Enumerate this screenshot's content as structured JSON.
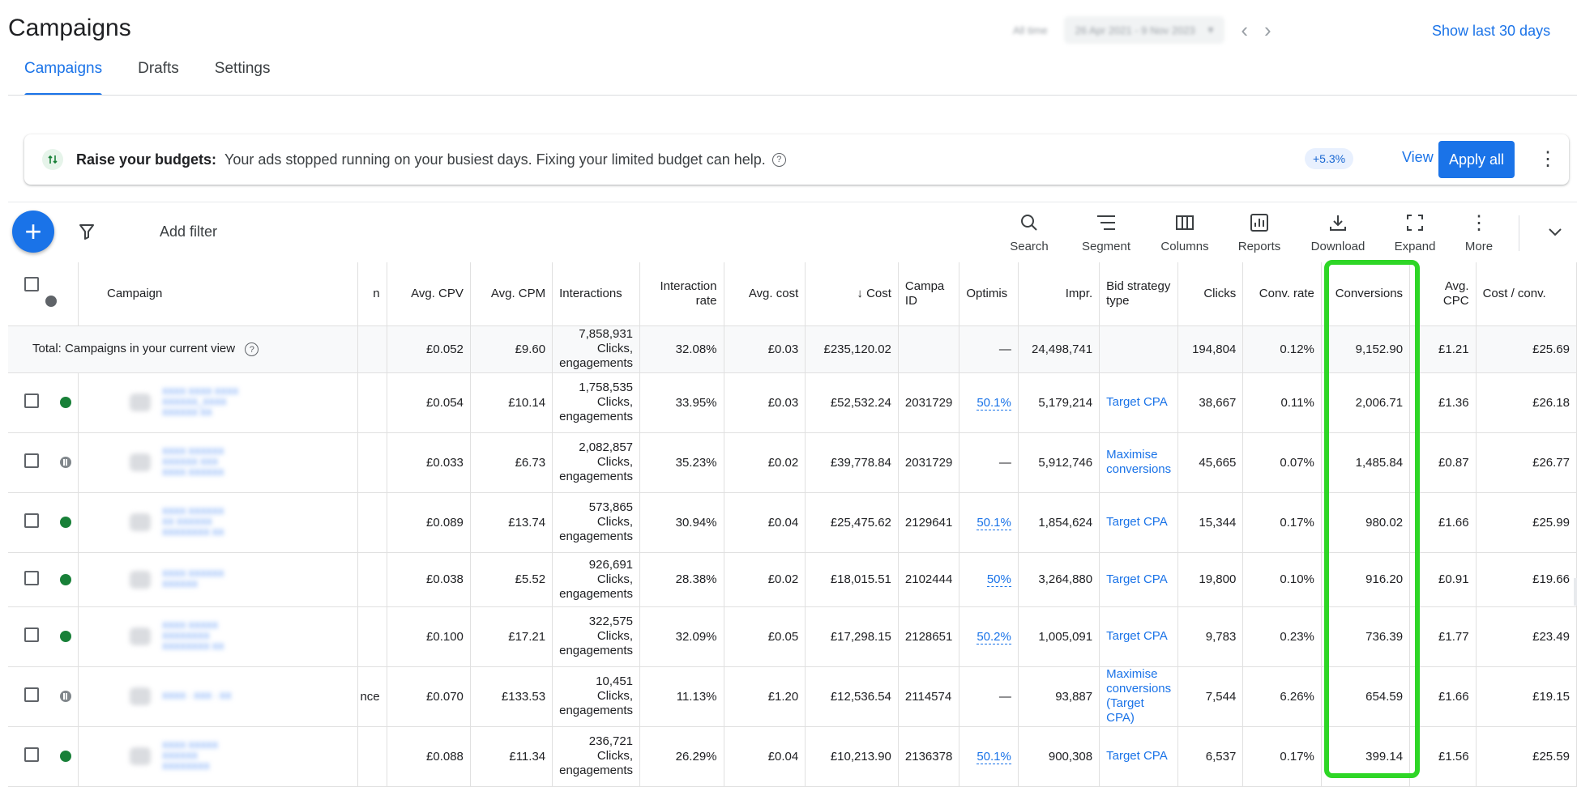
{
  "header": {
    "title": "Campaigns",
    "tabs": [
      "Campaigns",
      "Drafts",
      "Settings"
    ],
    "show_last": "Show last 30 days",
    "blurred_date_label": "All time",
    "blurred_date_range": "26 Apr 2021 - 9 Nov 2023"
  },
  "banner": {
    "title": "Raise your budgets:",
    "description": "Your ads stopped running on your busiest days. Fixing your limited budget can help.",
    "uplift": "+5.3%",
    "view": "View",
    "apply_all": "Apply all"
  },
  "toolbar": {
    "add_filter": "Add filter",
    "tools": [
      "Search",
      "Segment",
      "Columns",
      "Reports",
      "Download",
      "Expand",
      "More"
    ]
  },
  "table": {
    "headers": {
      "campaign": "Campaign",
      "avg_cpv": "Avg. CPV",
      "avg_cpm": "Avg. CPM",
      "interactions": "Interactions",
      "interaction_rate": "Interaction rate",
      "avg_cost": "Avg. cost",
      "cost": "Cost",
      "campaign_id": "Campa ID",
      "optimisation": "Optimis",
      "impr": "Impr.",
      "bid_strategy": "Bid strategy type",
      "clicks": "Clicks",
      "conv_rate": "Conv. rate",
      "conversions": "Conversions",
      "avg_cpc": "Avg. CPC",
      "cost_per_conv": "Cost / conv."
    },
    "total": {
      "label": "Total: Campaigns in your current view",
      "avg_cpv": "£0.052",
      "avg_cpm": "£9.60",
      "interactions": "7,858,931 Clicks, engagements",
      "interaction_rate": "32.08%",
      "avg_cost": "£0.03",
      "cost": "£235,120.02",
      "campaign_id": "",
      "optimisation": "—",
      "impr": "24,498,741",
      "bid_strategy": "",
      "clicks": "194,804",
      "conv_rate": "0.12%",
      "conversions": "9,152.90",
      "avg_cpc": "£1.21",
      "cost_per_conv": "£25.69"
    },
    "rows": [
      {
        "status": "enabled",
        "extra": "",
        "avg_cpv": "£0.054",
        "avg_cpm": "£10.14",
        "interactions": "1,758,535 Clicks, engagements",
        "interaction_rate": "33.95%",
        "avg_cost": "£0.03",
        "cost": "£52,532.24",
        "campaign_id": "2031729",
        "optimisation": "50.1%",
        "impr": "5,179,214",
        "bid_strategy": "Target CPA",
        "clicks": "38,667",
        "conv_rate": "0.11%",
        "conversions": "2,006.71",
        "avg_cpc": "£1.36",
        "cost_per_conv": "£26.18"
      },
      {
        "status": "paused",
        "extra": "",
        "avg_cpv": "£0.033",
        "avg_cpm": "£6.73",
        "interactions": "2,082,857 Clicks, engagements",
        "interaction_rate": "35.23%",
        "avg_cost": "£0.02",
        "cost": "£39,778.84",
        "campaign_id": "2031729",
        "optimisation": "—",
        "impr": "5,912,746",
        "bid_strategy": "Maximise conversions",
        "clicks": "45,665",
        "conv_rate": "0.07%",
        "conversions": "1,485.84",
        "avg_cpc": "£0.87",
        "cost_per_conv": "£26.77"
      },
      {
        "status": "enabled",
        "extra": "",
        "avg_cpv": "£0.089",
        "avg_cpm": "£13.74",
        "interactions": "573,865 Clicks, engagements",
        "interaction_rate": "30.94%",
        "avg_cost": "£0.04",
        "cost": "£25,475.62",
        "campaign_id": "2129641",
        "optimisation": "50.1%",
        "impr": "1,854,624",
        "bid_strategy": "Target CPA",
        "clicks": "15,344",
        "conv_rate": "0.17%",
        "conversions": "980.02",
        "avg_cpc": "£1.66",
        "cost_per_conv": "£25.99"
      },
      {
        "status": "enabled",
        "extra": "",
        "avg_cpv": "£0.038",
        "avg_cpm": "£5.52",
        "interactions": "926,691 Clicks, engagements",
        "interaction_rate": "28.38%",
        "avg_cost": "£0.02",
        "cost": "£18,015.51",
        "campaign_id": "2102444",
        "optimisation": "50%",
        "impr": "3,264,880",
        "bid_strategy": "Target CPA",
        "clicks": "19,800",
        "conv_rate": "0.10%",
        "conversions": "916.20",
        "avg_cpc": "£0.91",
        "cost_per_conv": "£19.66"
      },
      {
        "status": "enabled",
        "extra": "",
        "avg_cpv": "£0.100",
        "avg_cpm": "£17.21",
        "interactions": "322,575 Clicks, engagements",
        "interaction_rate": "32.09%",
        "avg_cost": "£0.05",
        "cost": "£17,298.15",
        "campaign_id": "2128651",
        "optimisation": "50.2%",
        "impr": "1,005,091",
        "bid_strategy": "Target CPA",
        "clicks": "9,783",
        "conv_rate": "0.23%",
        "conversions": "736.39",
        "avg_cpc": "£1.77",
        "cost_per_conv": "£23.49"
      },
      {
        "status": "paused",
        "extra": "nce",
        "avg_cpv": "£0.070",
        "avg_cpm": "£133.53",
        "interactions": "10,451 Clicks, engagements",
        "interaction_rate": "11.13%",
        "avg_cost": "£1.20",
        "cost": "£12,536.54",
        "campaign_id": "2114574",
        "optimisation": "—",
        "impr": "93,887",
        "bid_strategy": "Maximise conversions (Target CPA)",
        "clicks": "7,544",
        "conv_rate": "6.26%",
        "conversions": "654.59",
        "avg_cpc": "£1.66",
        "cost_per_conv": "£19.15"
      },
      {
        "status": "enabled",
        "extra": "",
        "avg_cpv": "£0.088",
        "avg_cpm": "£11.34",
        "interactions": "236,721 Clicks, engagements",
        "interaction_rate": "26.29%",
        "avg_cost": "£0.04",
        "cost": "£10,213.90",
        "campaign_id": "2136378",
        "optimisation": "50.1%",
        "impr": "900,308",
        "bid_strategy": "Target CPA",
        "clicks": "6,537",
        "conv_rate": "0.17%",
        "conversions": "399.14",
        "avg_cpc": "£1.56",
        "cost_per_conv": "£25.59"
      }
    ]
  },
  "colors": {
    "accent": "#1a73e8",
    "enabled_status": "#188038",
    "highlight": "#2ed626"
  }
}
